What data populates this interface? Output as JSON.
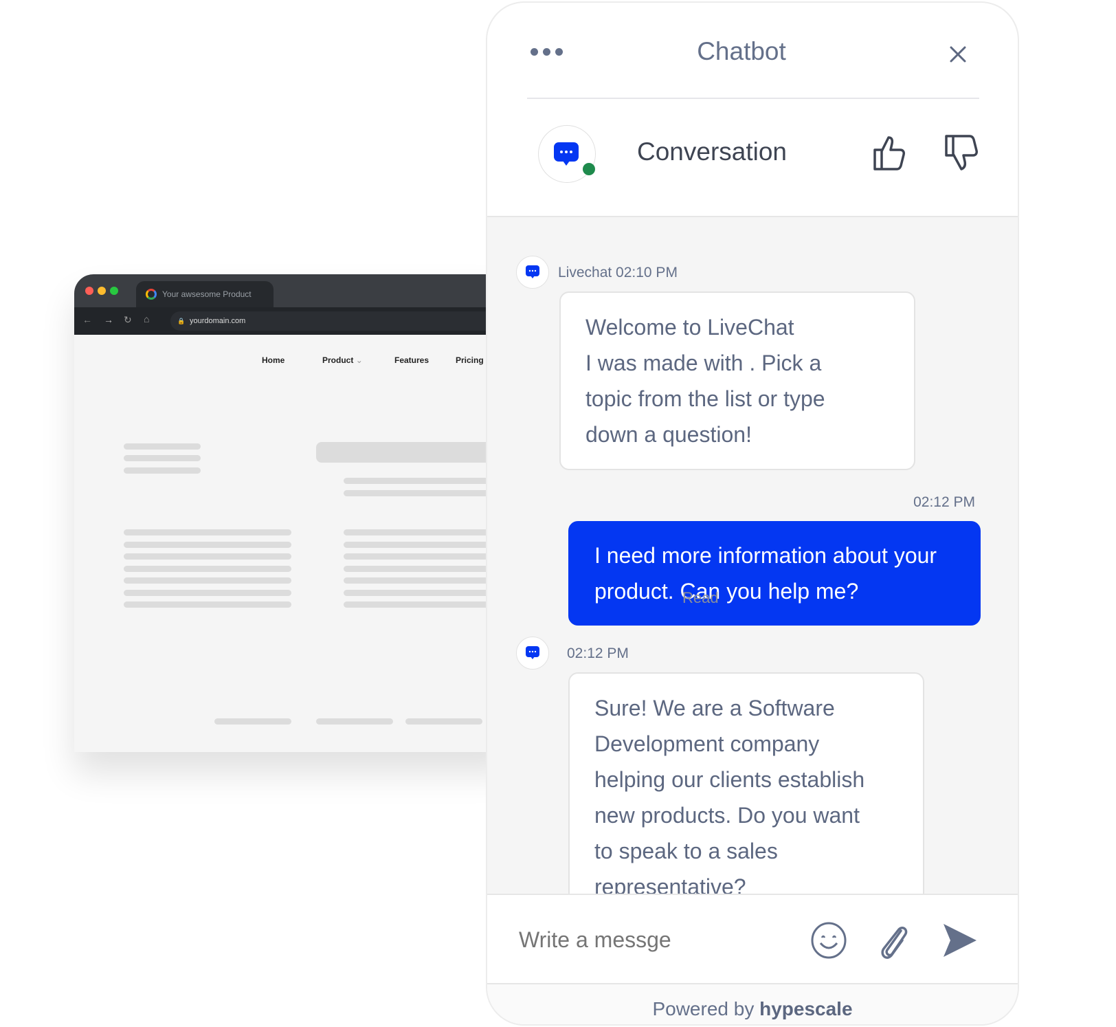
{
  "browser": {
    "tab_title": "Your awsesome Product",
    "url": "yourdomain.com",
    "nav": [
      "Home",
      "Product",
      "Features",
      "Pricing"
    ]
  },
  "widget": {
    "title": "Chatbot",
    "conversation_title": "Conversation",
    "status": "online",
    "accent_color": "#0437f2",
    "online_color": "#1e8a4c",
    "messages": [
      {
        "sender": "bot",
        "meta": "Livechat 02:10 PM",
        "text": [
          "Welcome to LiveChat",
          "I was made with . Pick a",
          "topic from the list or type",
          "down a question!"
        ]
      },
      {
        "sender": "user",
        "meta": "02:12 PM",
        "text": [
          "I need more information about your",
          "product. Can you help me?"
        ],
        "status": "Read"
      },
      {
        "sender": "bot",
        "meta": "02:12 PM",
        "text": [
          "Sure! We are a Software",
          "Development company",
          "helping our clients establish",
          "new products. Do you want",
          "to speak to a sales",
          "representative?"
        ]
      }
    ],
    "input_placeholder": "Write a messge",
    "footer_prefix": "Powered by",
    "footer_brand": "hypescale"
  }
}
